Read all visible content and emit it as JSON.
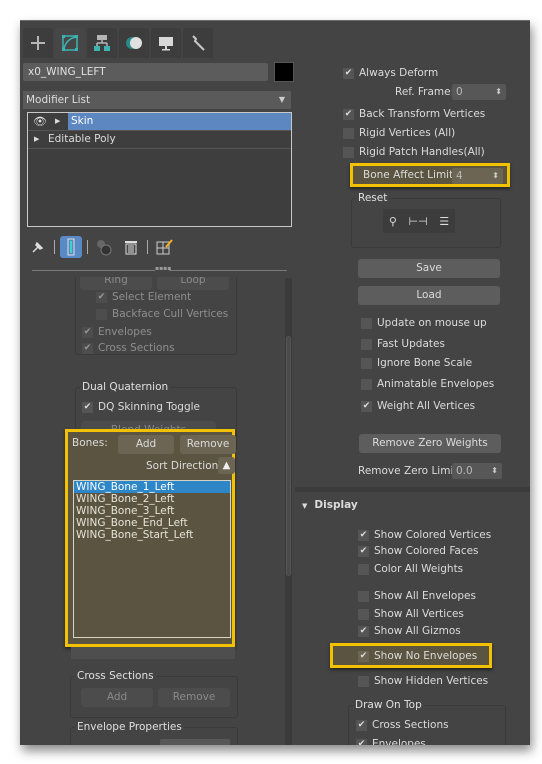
{
  "tabs": [
    {
      "name": "create",
      "icon": "plus-icon"
    },
    {
      "name": "modify",
      "icon": "modify-icon",
      "active": true
    },
    {
      "name": "hierarchy",
      "icon": "hierarchy-icon"
    },
    {
      "name": "motion",
      "icon": "motion-icon"
    },
    {
      "name": "display",
      "icon": "display-icon"
    },
    {
      "name": "utilities",
      "icon": "wrench-icon"
    }
  ],
  "object_name": "x0_WING_LEFT",
  "object_color": "#000000",
  "modifier_list": {
    "label": "Modifier List"
  },
  "stack": [
    {
      "label": "Skin",
      "selected": true
    },
    {
      "label": "Editable Poly",
      "selected": false
    }
  ],
  "left_panel": {
    "cut_buttons": [
      "Ring",
      "Loop"
    ],
    "select_element": "Select Element",
    "backface_cull": "Backface Cull Vertices",
    "envelopes": "Envelopes",
    "cross_sections": "Cross Sections",
    "dual_quaternion": {
      "title": "Dual Quaternion",
      "toggle": "DQ Skinning Toggle",
      "blend_weights": "Blend Weights"
    },
    "bones": {
      "label": "Bones:",
      "add": "Add",
      "remove": "Remove",
      "sort_direction": "Sort Direction:",
      "items": [
        "WING_Bone_1_Left",
        "WING_Bone_2_Left",
        "WING_Bone_3_Left",
        "WING_Bone_End_Left",
        "WING_Bone_Start_Left"
      ],
      "selected_index": 0
    },
    "cross_sections_group": {
      "title": "Cross Sections",
      "add": "Add",
      "remove": "Remove"
    },
    "envelope_properties": {
      "title": "Envelope Properties"
    }
  },
  "right_panel": {
    "always_deform": {
      "label": "Always Deform",
      "checked": true
    },
    "ref_frame": {
      "label": "Ref. Frame:",
      "value": "0"
    },
    "back_transform": {
      "label": "Back Transform Vertices",
      "checked": true
    },
    "rigid_vertices": {
      "label": "Rigid Vertices (All)",
      "checked": false
    },
    "rigid_patch": {
      "label": "Rigid Patch Handles(All)",
      "checked": false
    },
    "bone_affect_limit": {
      "label": "Bone Affect Limit:",
      "value": "4"
    },
    "reset": {
      "title": "Reset"
    },
    "save": "Save",
    "load": "Load",
    "update_mouse_up": {
      "label": "Update on mouse up",
      "checked": false
    },
    "fast_updates": {
      "label": "Fast Updates",
      "checked": false
    },
    "ignore_bone_scale": {
      "label": "Ignore Bone Scale",
      "checked": false
    },
    "animatable_envelopes": {
      "label": "Animatable Envelopes",
      "checked": false
    },
    "weight_all_vertices": {
      "label": "Weight All Vertices",
      "checked": true
    },
    "remove_zero_weights": "Remove Zero Weights",
    "remove_zero_limit": {
      "label": "Remove Zero Limit:",
      "value": "0.0"
    },
    "display": {
      "title": "Display",
      "show_colored_vertices": {
        "label": "Show Colored Vertices",
        "checked": true
      },
      "show_colored_faces": {
        "label": "Show Colored Faces",
        "checked": true
      },
      "color_all_weights": {
        "label": "Color All Weights",
        "checked": false
      },
      "show_all_envelopes": {
        "label": "Show All Envelopes",
        "checked": false
      },
      "show_all_vertices": {
        "label": "Show All Vertices",
        "checked": false
      },
      "show_all_gizmos": {
        "label": "Show All Gizmos",
        "checked": true
      },
      "show_no_envelopes": {
        "label": "Show No Envelopes",
        "checked": true
      },
      "show_hidden_vertices": {
        "label": "Show Hidden Vertices",
        "checked": false
      },
      "draw_on_top": {
        "title": "Draw On Top",
        "cross_sections": {
          "label": "Cross Sections",
          "checked": true
        },
        "envelopes": {
          "label": "Envelopes",
          "checked": true
        }
      }
    }
  },
  "colors": {
    "highlight": "#f2c100",
    "selection": "#2c86c8",
    "stack_selection": "#5c87c0",
    "accent": "#3bb3b3"
  }
}
